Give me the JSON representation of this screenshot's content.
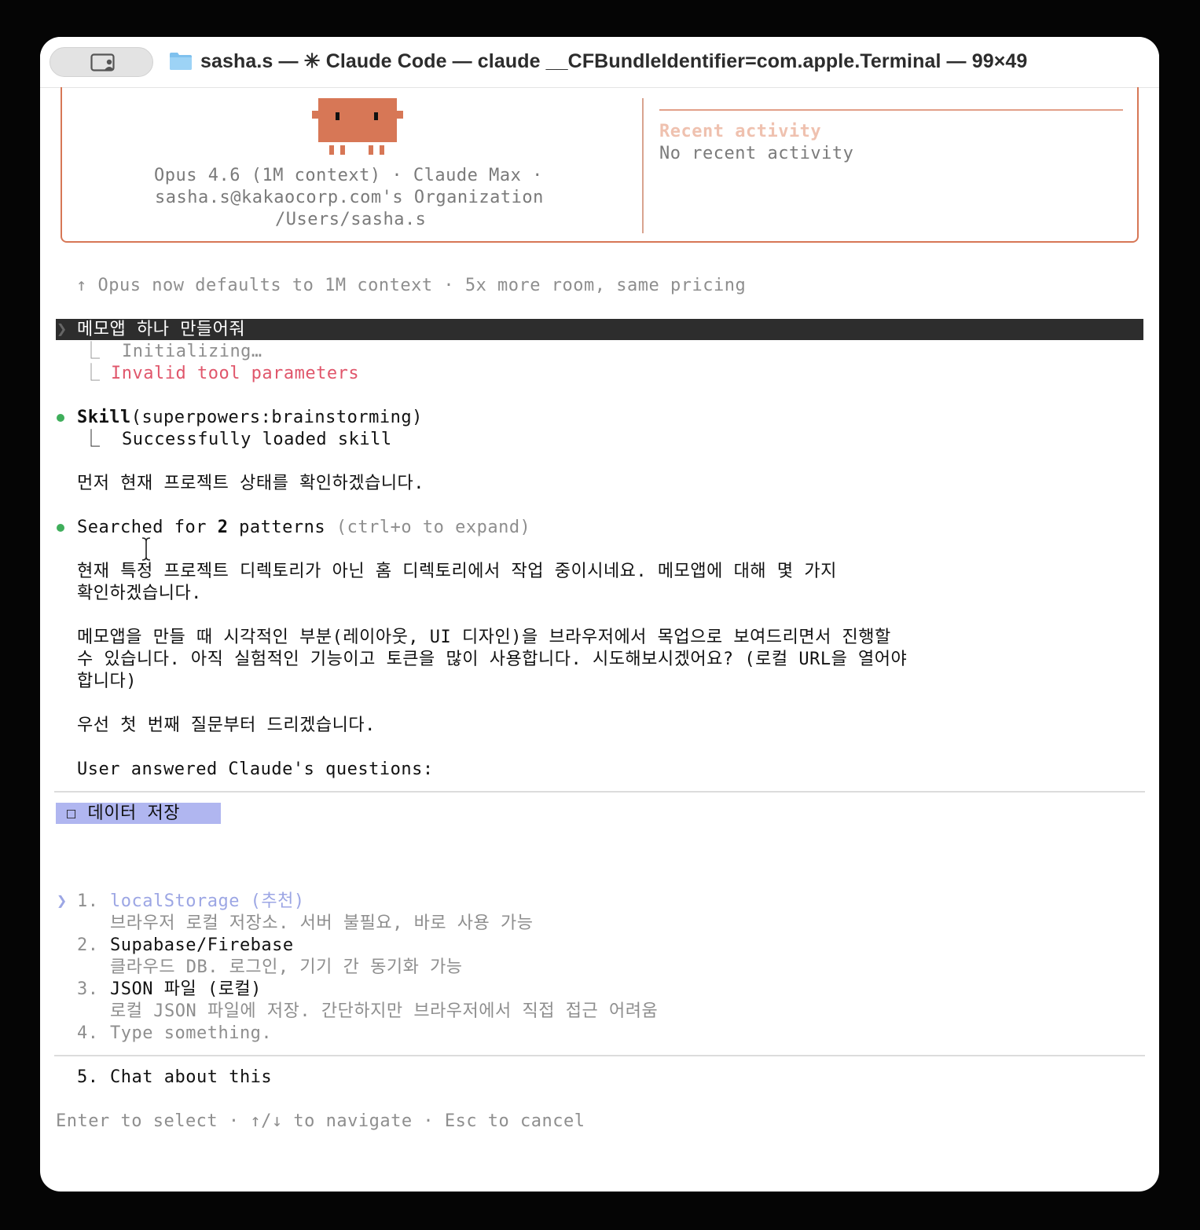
{
  "window": {
    "title": "sasha.s — ✳ Claude Code — claude __CFBundleIdentifier=com.apple.Terminal — 99×49"
  },
  "header": {
    "model_line": "Opus 4.6 (1M context) · Claude Max ·",
    "org_line": "sasha.s@kakaocorp.com's Organization",
    "path_line": "/Users/sasha.s",
    "recent_title": "Recent activity",
    "recent_value": "No recent activity"
  },
  "notice": "↑ Opus now defaults to 1M context · 5x more room, same pricing",
  "prompt": {
    "caret": "❯",
    "text": "메모앱 하나 만들어줘",
    "sub1": "⎿  Initializing…",
    "sub2_prefix": "⎿  ",
    "sub2": "Invalid tool parameters"
  },
  "skill": {
    "name": "Skill",
    "args": "(superpowers:brainstorming)",
    "result": "⎿  Successfully loaded skill"
  },
  "messages": {
    "m1": "먼저 현재 프로젝트 상태를 확인하겠습니다.",
    "search_a": "Searched for ",
    "search_n": "2",
    "search_b": " patterns ",
    "search_hint": "(ctrl+o to expand)",
    "m2_l1": "현재 특정 프로젝트 디렉토리가 아닌 홈 디렉토리에서 작업 중이시네요. 메모앱에 대해 몇 가지",
    "m2_l2": "확인하겠습니다.",
    "m3_l1": "메모앱을 만들 때 시각적인 부분(레이아웃, UI 디자인)을 브라우저에서 목업으로 보여드리면서 진행할",
    "m3_l2": "수 있습니다. 아직 실험적인 기능이고 토큰을 많이 사용합니다. 시도해보시겠어요? (로컬 URL을 열어야",
    "m3_l3": "합니다)",
    "m4": "우선 첫 번째 질문부터 드리겠습니다.",
    "m5": "User answered Claude's questions:"
  },
  "question": {
    "tab_label": "☐ 데이터 저장",
    "options": [
      {
        "num": "1.",
        "label": "localStorage (추천)",
        "desc": "브라우저 로컬 저장소. 서버 불필요, 바로 사용 가능"
      },
      {
        "num": "2.",
        "label": "Supabase/Firebase",
        "desc": "클라우드 DB. 로그인, 기기 간 동기화 가능"
      },
      {
        "num": "3.",
        "label": "JSON 파일 (로컬)",
        "desc": "로컬 JSON 파일에 저장. 간단하지만 브라우저에서 직접 접근 어려움"
      },
      {
        "num": "4.",
        "label": "Type something."
      },
      {
        "num": "5.",
        "label": "Chat about this"
      }
    ],
    "selected_caret": "❯",
    "footer": "Enter to select · ↑/↓ to navigate · Esc to cancel"
  },
  "colors": {
    "accent": "#d77756",
    "selected": "#9ca6e4",
    "error": "#e0566b",
    "success": "#3fae5b"
  }
}
